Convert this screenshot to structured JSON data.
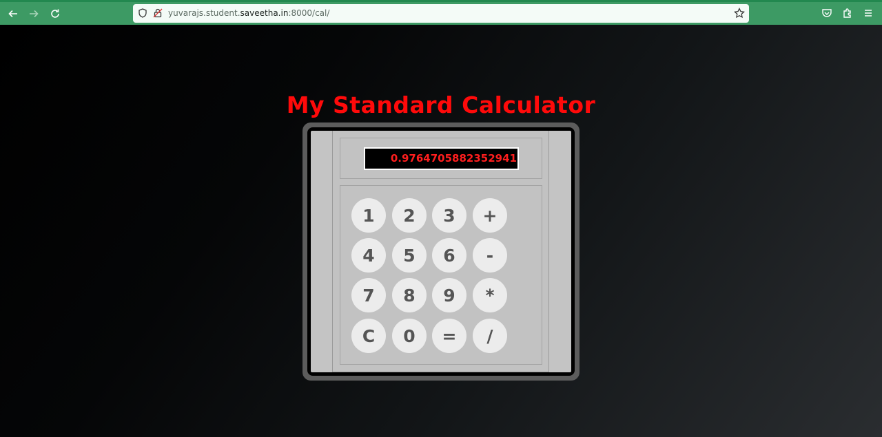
{
  "browser": {
    "url_prefix": "yuvarajs.student.",
    "url_host": "saveetha.in",
    "url_suffix": ":8000/cal/",
    "icons": [
      "back-icon",
      "forward-icon",
      "reload-icon",
      "shield-icon",
      "lock-icon",
      "star-icon",
      "pocket-icon",
      "extensions-icon",
      "menu-icon"
    ]
  },
  "calculator": {
    "title": "My Standard Calculator",
    "display_value": "0.9764705882352941",
    "keys": [
      [
        "1",
        "2",
        "3",
        "+"
      ],
      [
        "4",
        "5",
        "6",
        "-"
      ],
      [
        "7",
        "8",
        "9",
        "*"
      ],
      [
        "C",
        "0",
        "=",
        "/"
      ]
    ]
  },
  "colors": {
    "chrome": "#3d9a64",
    "title": "#ff0a0a",
    "display_text": "#ff1e1e",
    "key_bg": "#ececec",
    "key_text": "#555555"
  }
}
